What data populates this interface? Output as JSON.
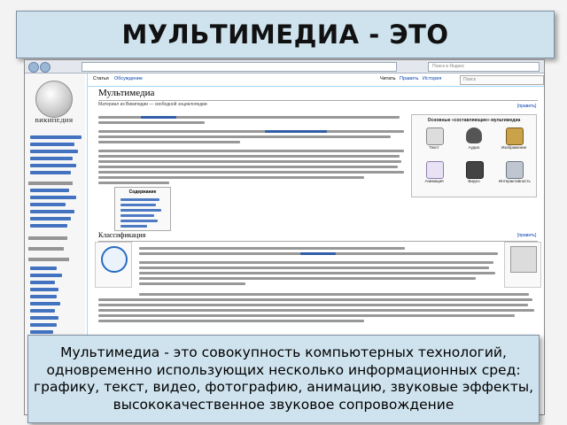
{
  "slide": {
    "title": "МУЛЬТИМЕДИА - ЭТО",
    "definition": "Мультимедиа - это совокупность компьютерных технологий, одновременно использующих несколько информационных сред: графику, текст, видео, фотографию, анимацию, звуковые эффекты, высококачественное звуковое сопровождение"
  },
  "colors": {
    "banner_bg": "#cfe3ee",
    "link": "#0645ad",
    "wiki_border": "#a7d7f9"
  },
  "browser": {
    "search_placeholder": "Поиск в Яндекс",
    "wiki": {
      "logo_text": "ВИКИПЕДИЯ",
      "tabs": [
        "Статья",
        "Обсуждение",
        "Читать",
        "Править",
        "История"
      ],
      "search_placeholder": "Поиск",
      "article_title": "Мультимедиа",
      "subtitle": "Материал из Википедии — свободной энциклопедии",
      "media_box_title": "Основные «составляющие» мультимедиа",
      "media_items": [
        "Текст",
        "Аудио",
        "Изображение",
        "Анимация",
        "Видео",
        "Интерактивность"
      ],
      "toc_title": "Содержание",
      "section_title": "Классификация",
      "edit_label": "[править]"
    }
  }
}
